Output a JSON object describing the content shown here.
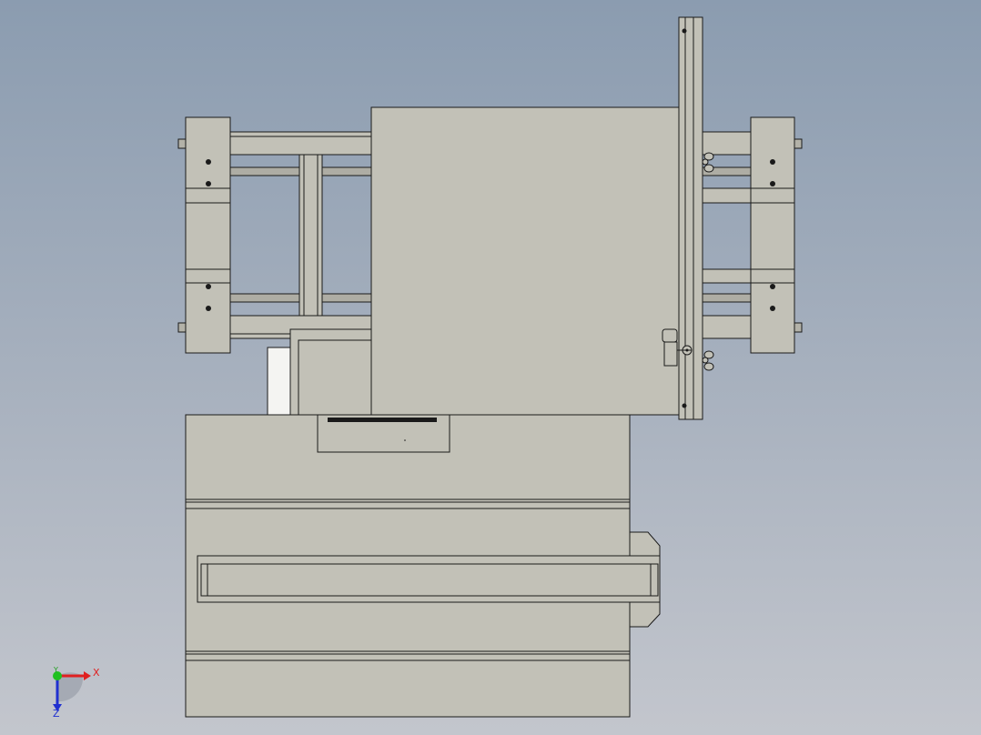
{
  "viewport": {
    "background_top": "#8b9cb0",
    "background_bottom": "#c3c6cd"
  },
  "model": {
    "part_fill": "#c2c1b7",
    "part_fill_dark": "#b3b2a8",
    "edge_color": "#1a1a1a",
    "highlight_fill": "#f4f4f2"
  },
  "triad": {
    "x_label": "X",
    "y_label": "Y",
    "z_label": "Z",
    "x_color": "#e02020",
    "y_color": "#20c020",
    "z_color": "#2030d0"
  }
}
